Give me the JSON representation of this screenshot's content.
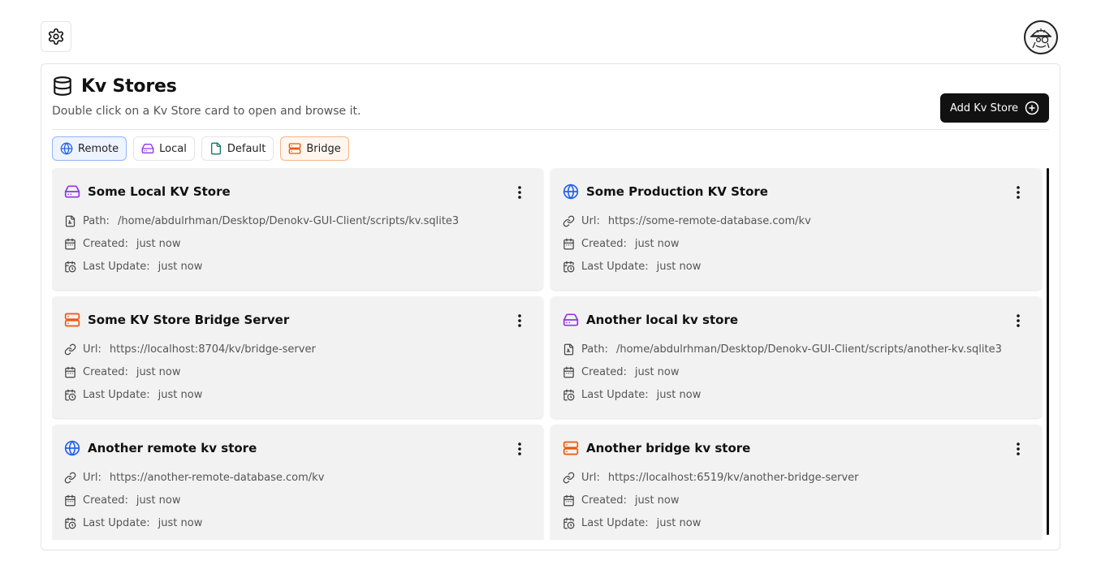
{
  "header": {
    "settings_icon": "gear-icon",
    "avatar_icon": "user-avatar"
  },
  "panel": {
    "title": "Kv Stores",
    "subtitle": "Double click on a Kv Store card to open and browse it.",
    "add_button": "Add Kv Store"
  },
  "filters": [
    {
      "label": "Remote",
      "icon": "globe-icon",
      "color": "#2563eb"
    },
    {
      "label": "Local",
      "icon": "drive-icon",
      "color": "#9333ea"
    },
    {
      "label": "Default",
      "icon": "file-icon",
      "color": "#0f766e"
    },
    {
      "label": "Bridge",
      "icon": "server-icon",
      "color": "#ea580c"
    }
  ],
  "labels": {
    "created": "Created:",
    "updated": "Last Update:"
  },
  "cards": [
    {
      "title": "Some Local KV Store",
      "type": "local",
      "loc_label": "Path:",
      "loc_value": "/home/abdulrhman/Desktop/Denokv-GUI-Client/scripts/kv.sqlite3",
      "created": "just now",
      "updated": "just now"
    },
    {
      "title": "Some Production KV Store",
      "type": "remote",
      "loc_label": "Url:",
      "loc_value": "https://some-remote-database.com/kv",
      "created": "just now",
      "updated": "just now"
    },
    {
      "title": "Some KV Store Bridge Server",
      "type": "bridge",
      "loc_label": "Url:",
      "loc_value": "https://localhost:8704/kv/bridge-server",
      "created": "just now",
      "updated": "just now"
    },
    {
      "title": "Another local kv store",
      "type": "local",
      "loc_label": "Path:",
      "loc_value": "/home/abdulrhman/Desktop/Denokv-GUI-Client/scripts/another-kv.sqlite3",
      "created": "just now",
      "updated": "just now"
    },
    {
      "title": "Another remote kv store",
      "type": "remote",
      "loc_label": "Url:",
      "loc_value": "https://another-remote-database.com/kv",
      "created": "just now",
      "updated": "just now"
    },
    {
      "title": "Another bridge kv store",
      "type": "bridge",
      "loc_label": "Url:",
      "loc_value": "https://localhost:6519/kv/another-bridge-server",
      "created": "just now",
      "updated": "just now"
    }
  ]
}
